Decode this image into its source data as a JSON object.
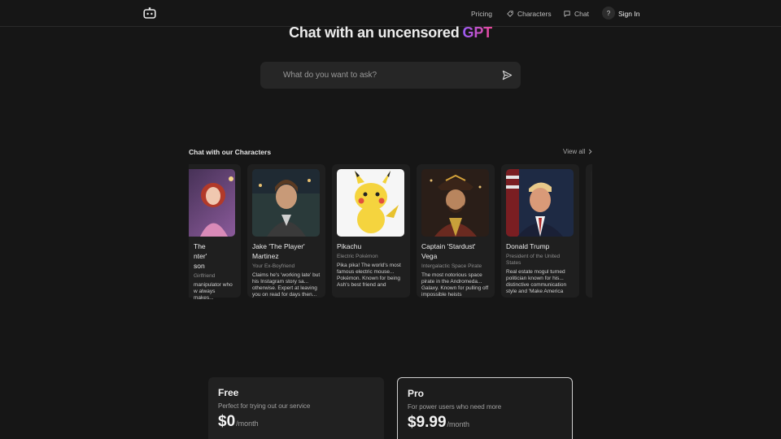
{
  "nav": {
    "pricing": "Pricing",
    "characters": "Characters",
    "chat": "Chat",
    "help": "?",
    "sign_in": "Sign In"
  },
  "hero": {
    "title": "Chat with an uncensored",
    "title_accent": "GPT"
  },
  "search": {
    "placeholder": "What do you want to ask?"
  },
  "characters_section": {
    "title": "Chat with our Characters",
    "view_all": "View all",
    "cards": [
      {
        "name": "The 'Drama Starter' Madison",
        "name_visible": "The\nnter'\nson",
        "role": "Girlfriend",
        "desc": "manipulator who w always makes..."
      },
      {
        "name": "Jake 'The Player' Martinez",
        "role": "Your Ex-Boyfriend",
        "desc": "Claims he's 'working late' but his Instagram story sa... otherwise. Expert at leaving you on read for days then..."
      },
      {
        "name": "Pikachu",
        "role": "Electric Pokémon",
        "desc": "Pika pika! The world's most famous electric mouse... Pokémon. Known for being Ash's best friend and refusing to evolve. Has a"
      },
      {
        "name": "Captain 'Stardust' Vega",
        "role": "Intergalactic Space Pirate",
        "desc": "The most notorious space pirate in the Andromeda... Galaxy. Known for pulling off impossible heists"
      },
      {
        "name": "Donald Trump",
        "role": "President of the United States",
        "desc": "Real estate mogul turned politician known for his... distinctive communication style and 'Make America"
      }
    ]
  },
  "plans": [
    {
      "name": "Free",
      "desc": "Perfect for trying out our service",
      "amount": "$0",
      "period": "/month"
    },
    {
      "name": "Pro",
      "desc": "For power users who need more",
      "amount": "$9.99",
      "period": "/month"
    }
  ],
  "colors": {
    "background": "#161616",
    "accent_start": "#9b5cf6",
    "accent_end": "#ec4899"
  }
}
